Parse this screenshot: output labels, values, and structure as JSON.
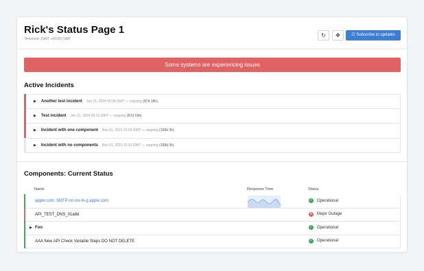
{
  "page": {
    "title": "Rick's Status Page 1",
    "timezone": "Timezone: (GMT +00:00) GMT",
    "refresh_icon": "refresh-icon",
    "expand_icon": "expand-icon",
    "subscribe_label": "Subscribe to updates",
    "subscribe_icon": "rss-icon"
  },
  "banner": {
    "text": "Some systems are experiencing issues",
    "color": "#e06262"
  },
  "incidents": {
    "heading": "Active Incidents",
    "items": [
      {
        "name": "Another test incident",
        "meta": "Jan 21, 2024 00:39 GMT — ongoing",
        "duration": "(87d 18h)",
        "color": "#e06262"
      },
      {
        "name": "Test incident",
        "meta": "Jan 21, 2024 00:16 GMT — ongoing",
        "duration": "(87d 18h)",
        "color": "#e06262"
      },
      {
        "name": "Incident with one component",
        "meta": "Nov 01, 2023 15:59 GMT — ongoing",
        "duration": "(168d 3h)",
        "color": "#e06262"
      },
      {
        "name": "Incident with no components",
        "meta": "Nov 01, 2023 15:53 GMT — ongoing",
        "duration": "(168d 3h)",
        "color": "#dfe9f7"
      }
    ]
  },
  "components": {
    "heading": "Components: Current Status",
    "columns": {
      "name": "Name",
      "response": "Response Time",
      "status": "Status"
    },
    "rows": [
      {
        "name": "apple.com: SMTP on mx-in-g.apple.com",
        "status": "Operational",
        "status_color": "#43a65a",
        "bar_color": "#43a65a"
      },
      {
        "name": "API_TEST_DNS_01a8d",
        "status": "Major Outage",
        "status_color": "#e06262",
        "bar_color": "#e06262"
      },
      {
        "name": "Foo",
        "status": "Operational",
        "status_color": "#43a65a",
        "bar_color": "#43a65a"
      },
      {
        "name": "AAA New API Check Variable Steps DO NOT DELETE",
        "status": "Operational",
        "status_color": "#43a65a",
        "bar_color": "#43a65a"
      }
    ]
  }
}
